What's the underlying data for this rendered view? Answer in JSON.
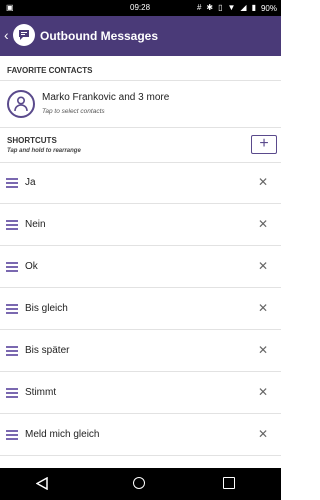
{
  "status_bar": {
    "time": "09:28",
    "battery": "90%",
    "left_icon": "image-icon",
    "right_icons": [
      "hashtag-icon",
      "bluetooth-icon",
      "vibrate-icon",
      "wifi-icon",
      "signal-icon",
      "battery-icon"
    ]
  },
  "app_bar": {
    "title": "Outbound Messages",
    "back_icon": "back-arrow-icon",
    "logo_icon": "chat-bubble-icon",
    "color": "#4a3a78"
  },
  "favorites": {
    "header": "FAVORITE CONTACTS",
    "contact_name": "Marko Frankovic and 3 more",
    "contact_hint": "Tap to select contacts"
  },
  "shortcuts": {
    "header": "SHORTCUTS",
    "hint": "Tap and hold to rearrange",
    "add_label": "+",
    "items": [
      {
        "label": "Ja"
      },
      {
        "label": "Nein"
      },
      {
        "label": "Ok"
      },
      {
        "label": "Bis gleich"
      },
      {
        "label": "Bis später"
      },
      {
        "label": "Stimmt"
      },
      {
        "label": "Meld mich gleich"
      }
    ]
  },
  "nav_bar": {
    "back": "nav-back-icon",
    "home": "nav-home-icon",
    "recents": "nav-recents-icon"
  }
}
